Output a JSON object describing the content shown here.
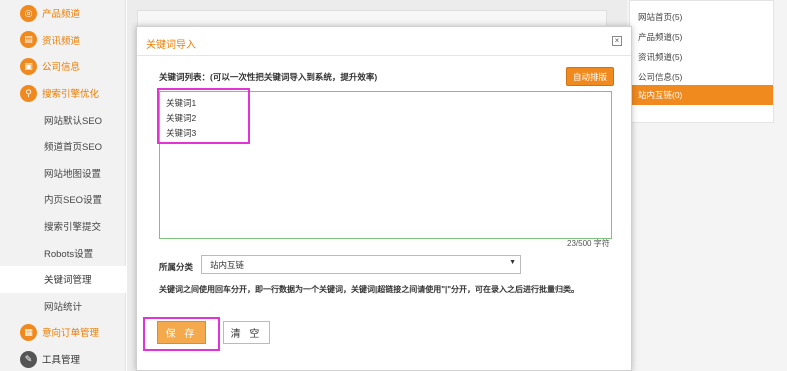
{
  "sidebar": {
    "main_items": [
      {
        "label": "产品频道",
        "icon": "target-icon"
      },
      {
        "label": "资讯频道",
        "icon": "document-icon"
      },
      {
        "label": "公司信息",
        "icon": "building-icon"
      },
      {
        "label": "搜索引擎优化",
        "icon": "search-icon"
      }
    ],
    "sub_items": [
      "网站默认SEO",
      "频道首页SEO",
      "网站地图设置",
      "内页SEO设置",
      "搜索引擎提交",
      "Robots设置",
      "关键词管理",
      "网站统计"
    ],
    "bottom_items": [
      {
        "label": "意向订单管理",
        "icon": "order-icon"
      },
      {
        "label": "工具管理",
        "icon": "tools-icon"
      }
    ]
  },
  "right_panel": {
    "items": [
      "网站首页(5)",
      "产品频道(5)",
      "资讯频道(5)",
      "公司信息(5)",
      "站内互链(0)"
    ],
    "active_index": 4
  },
  "dialog": {
    "title": "关键词导入",
    "close_icon": "×",
    "keyword_list_label": "关键词列表：(可以一次性把关键词导入到系统，提升效率)",
    "auto_sort_button": "自动排版",
    "keywords": [
      "关键词1",
      "关键词2",
      "关键词3"
    ],
    "counter": "23/500 字符",
    "category_label": "所属分类",
    "category_value": "站内互链",
    "note": "关键词之间使用回车分开，即一行数据为一个关键词，关键词|超链接之间请使用\"|\"分开，可在录入之后进行批量归类。",
    "save_button": "保 存",
    "clear_button": "清 空"
  },
  "colors": {
    "accent": "#f08a1f",
    "highlight": "#e233d6",
    "textarea_border": "#7cc47c"
  }
}
